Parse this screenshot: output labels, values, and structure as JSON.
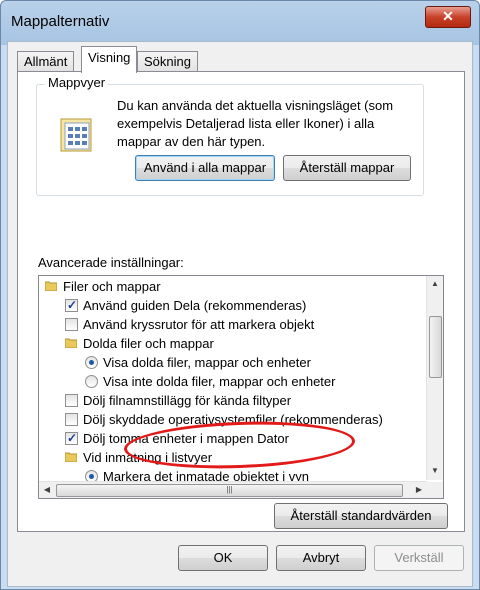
{
  "window": {
    "title": "Mappalternativ",
    "close_glyph": "✕"
  },
  "tabs": [
    {
      "label": "Allmänt"
    },
    {
      "label": "Visning"
    },
    {
      "label": "Sökning"
    }
  ],
  "folder_views": {
    "legend": "Mappvyer",
    "description": "Du kan använda det aktuella visningsläget (som exempelvis Detaljerad lista eller Ikoner) i alla mappar av den här typen.",
    "apply_button": "Använd i alla mappar",
    "reset_button": "Återställ mappar"
  },
  "advanced": {
    "label": "Avancerade inställningar:",
    "items": [
      {
        "type": "folder",
        "text": "Filer och mappar",
        "level": 0
      },
      {
        "type": "checkbox",
        "text": "Använd guiden Dela (rekommenderas)",
        "checked": true,
        "level": 1
      },
      {
        "type": "checkbox",
        "text": "Använd kryssrutor för att markera objekt",
        "checked": false,
        "level": 1
      },
      {
        "type": "folder",
        "text": "Dolda filer och mappar",
        "level": 1
      },
      {
        "type": "radio",
        "text": "Visa dolda filer, mappar och enheter",
        "checked": true,
        "level": 2
      },
      {
        "type": "radio",
        "text": "Visa inte dolda filer, mappar och enheter",
        "checked": false,
        "level": 2
      },
      {
        "type": "checkbox",
        "text": "Dölj filnamnstillägg för kända filtyper",
        "checked": false,
        "level": 1
      },
      {
        "type": "checkbox",
        "text": "Dölj skyddade operativsystemfiler (rekommenderas)",
        "checked": false,
        "level": 1
      },
      {
        "type": "checkbox",
        "text": "Dölj tomma enheter i mappen Dator",
        "checked": true,
        "level": 1
      },
      {
        "type": "folder",
        "text": "Vid inmatning i listvyer",
        "level": 1
      },
      {
        "type": "radio",
        "text": "Markera det inmatade objektet i vyn",
        "checked": true,
        "level": 2
      }
    ],
    "reset_defaults_button": "Återställ standardvärden",
    "highlight_color": "#e21a1a"
  },
  "footer": {
    "ok": "OK",
    "cancel": "Avbryt",
    "apply": "Verkställ"
  }
}
